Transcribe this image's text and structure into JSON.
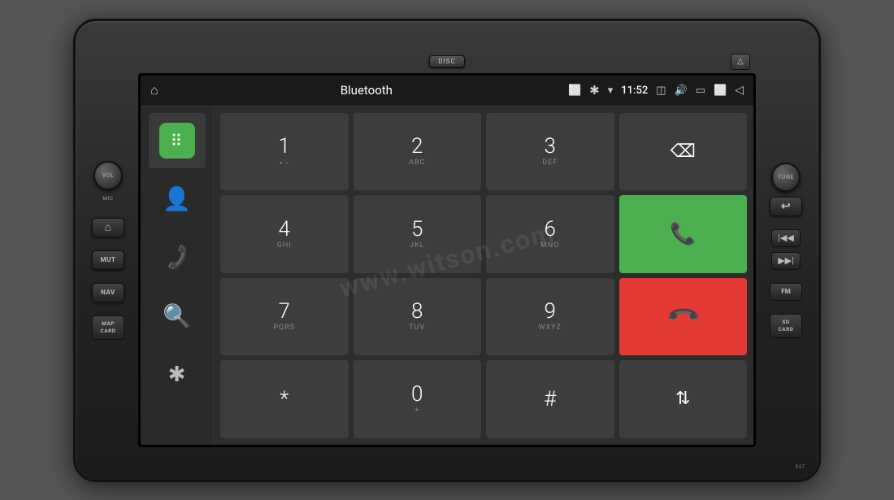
{
  "device": {
    "disc_label": "DISC",
    "rst_label": "RST",
    "vol_label": "VOL",
    "mic_label": "MIC",
    "tune_label": "TUNE",
    "mut_label": "MUT",
    "nav_label": "NAV",
    "fm_label": "FM",
    "map_card_label": "MAP\nCARD",
    "sd_card_label": "SD\nCARD"
  },
  "status_bar": {
    "title": "Bluetooth",
    "time": "11:52",
    "home_icon": "⌂",
    "bluetooth_icon": "✱",
    "wifi_icon": "▾",
    "photo_icon": "📷",
    "volume_icon": "🔊",
    "battery_icon": "▭",
    "window_icon": "⬜",
    "back_icon": "◁"
  },
  "watermark": {
    "text": "www.witson.com"
  },
  "sidebar": {
    "items": [
      {
        "icon": "⠿",
        "label": "dialpad",
        "active": true
      },
      {
        "icon": "👤",
        "label": "contacts"
      },
      {
        "icon": "📞",
        "label": "calls"
      },
      {
        "icon": "🔍",
        "label": "search"
      },
      {
        "icon": "✱",
        "label": "bluetooth"
      }
    ]
  },
  "dialpad": {
    "keys": [
      {
        "main": "1",
        "sub": "▪ ▫",
        "type": "normal"
      },
      {
        "main": "2",
        "sub": "ABC",
        "type": "normal"
      },
      {
        "main": "3",
        "sub": "DEF",
        "type": "normal"
      },
      {
        "main": "⌫",
        "sub": "",
        "type": "backspace"
      },
      {
        "main": "4",
        "sub": "GHI",
        "type": "normal"
      },
      {
        "main": "5",
        "sub": "JKL",
        "type": "normal"
      },
      {
        "main": "6",
        "sub": "MNO",
        "type": "normal"
      },
      {
        "main": "☎",
        "sub": "",
        "type": "green"
      },
      {
        "main": "7",
        "sub": "PQRS",
        "type": "normal"
      },
      {
        "main": "8",
        "sub": "TUV",
        "type": "normal"
      },
      {
        "main": "9",
        "sub": "WXYZ",
        "type": "normal"
      },
      {
        "main": "☎",
        "sub": "",
        "type": "red"
      },
      {
        "main": "*",
        "sub": "",
        "type": "normal"
      },
      {
        "main": "0",
        "sub": "+",
        "type": "normal"
      },
      {
        "main": "#",
        "sub": "",
        "type": "normal"
      },
      {
        "main": "⇅",
        "sub": "",
        "type": "normal"
      }
    ]
  }
}
